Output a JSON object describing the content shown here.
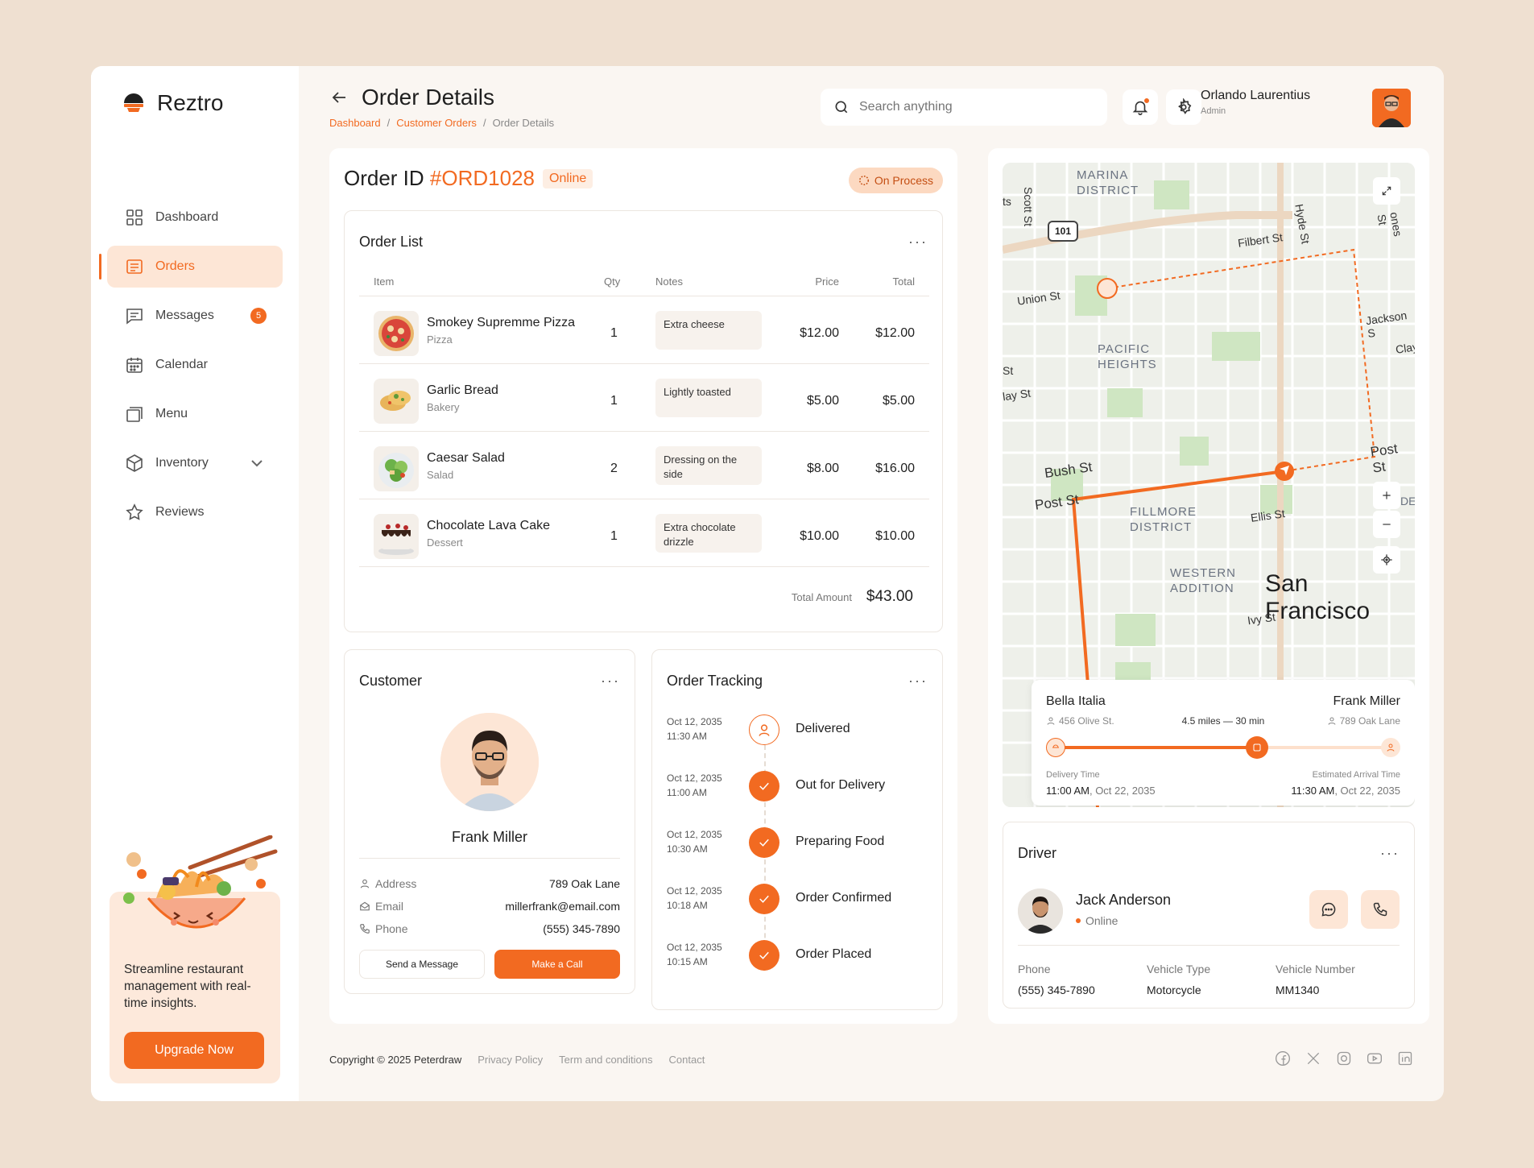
{
  "brand": {
    "name": "Reztro"
  },
  "sidebar": {
    "items": [
      {
        "label": "Dashboard",
        "icon": "grid-icon"
      },
      {
        "label": "Orders",
        "icon": "receipt-icon",
        "active": true
      },
      {
        "label": "Messages",
        "icon": "message-icon",
        "badge": "5"
      },
      {
        "label": "Calendar",
        "icon": "calendar-icon"
      },
      {
        "label": "Menu",
        "icon": "menu-book-icon"
      },
      {
        "label": "Inventory",
        "icon": "box-icon",
        "expandable": true
      },
      {
        "label": "Reviews",
        "icon": "star-icon"
      }
    ],
    "promo": {
      "text": "Streamline restaurant management with real-time insights.",
      "button": "Upgrade Now"
    }
  },
  "header": {
    "title": "Order Details",
    "breadcrumb": [
      "Dashboard",
      "Customer Orders",
      "Order Details"
    ],
    "search_placeholder": "Search anything",
    "user": {
      "name": "Orlando Laurentius",
      "role": "Admin"
    }
  },
  "order": {
    "id_label": "Order ID",
    "id": "#ORD1028",
    "channel": "Online",
    "status": "On Process",
    "list_title": "Order List",
    "columns": [
      "Item",
      "Qty",
      "Notes",
      "Price",
      "Total"
    ],
    "items": [
      {
        "name": "Smokey Supremme Pizza",
        "category": "Pizza",
        "qty": "1",
        "note": "Extra cheese",
        "price": "$12.00",
        "total": "$12.00"
      },
      {
        "name": "Garlic Bread",
        "category": "Bakery",
        "qty": "1",
        "note": "Lightly toasted",
        "price": "$5.00",
        "total": "$5.00"
      },
      {
        "name": "Caesar Salad",
        "category": "Salad",
        "qty": "2",
        "note": "Dressing on the side",
        "price": "$8.00",
        "total": "$16.00"
      },
      {
        "name": "Chocolate Lava Cake",
        "category": "Dessert",
        "qty": "1",
        "note": "Extra chocolate drizzle",
        "price": "$10.00",
        "total": "$10.00"
      }
    ],
    "total_label": "Total Amount",
    "total": "$43.00"
  },
  "customer": {
    "title": "Customer",
    "name": "Frank Miller",
    "address_label": "Address",
    "address": "789 Oak Lane",
    "email_label": "Email",
    "email": "millerfrank@email.com",
    "phone_label": "Phone",
    "phone": "(555) 345-7890",
    "message_button": "Send a Message",
    "call_button": "Make a Call"
  },
  "tracking": {
    "title": "Order Tracking",
    "steps": [
      {
        "date": "Oct 12, 2035",
        "time": "11:30 AM",
        "label": "Delivered",
        "state": "current"
      },
      {
        "date": "Oct 12, 2035",
        "time": "11:00 AM",
        "label": "Out for Delivery",
        "state": "done"
      },
      {
        "date": "Oct 12, 2035",
        "time": "10:30 AM",
        "label": "Preparing Food",
        "state": "done"
      },
      {
        "date": "Oct 12, 2035",
        "time": "10:18 AM",
        "label": "Order Confirmed",
        "state": "done"
      },
      {
        "date": "Oct 12, 2035",
        "time": "10:15 AM",
        "label": "Order Placed",
        "state": "done"
      }
    ]
  },
  "map": {
    "labels": {
      "marina": "MARINA",
      "marina2": "DISTRICT",
      "pacific": "PACIFIC",
      "pacific2": "HEIGHTS",
      "fillmore": "FILLMORE",
      "fillmore2": "DISTRICT",
      "western": "WESTERN",
      "western2": "ADDITION",
      "city": "San Francisco",
      "scott": "Scott St",
      "filbert": "Filbert St",
      "hyde": "Hyde St",
      "jones": "ones St",
      "union": "Union St",
      "jackson": "Jackson S",
      "clay": "Clay",
      "bush": "Bush St",
      "post": "Post St",
      "post2": "Post St",
      "ellis": "Ellis St",
      "ivy": "Ivy St",
      "highway": "101",
      "clay2": "lay St",
      "st": "St",
      "ts": "ts",
      "de": "DE"
    },
    "route": {
      "from_name": "Bella Italia",
      "from_addr": "456 Olive St.",
      "to_name": "Frank Miller",
      "to_addr": "789 Oak Lane",
      "distance": "4.5 miles",
      "duration": "30 min",
      "progress": 0.6,
      "delivery_label": "Delivery Time",
      "delivery_time": "11:00 AM",
      "delivery_date": ", Oct 22, 2035",
      "eta_label": "Estimated Arrival Time",
      "eta_time": "11:30 AM",
      "eta_date": ", Oct 22, 2035"
    }
  },
  "driver": {
    "title": "Driver",
    "name": "Jack Anderson",
    "status": "Online",
    "phone_label": "Phone",
    "phone": "(555) 345-7890",
    "vehicle_label": "Vehicle Type",
    "vehicle": "Motorcycle",
    "number_label": "Vehicle Number",
    "number": "MM1340"
  },
  "footer": {
    "copyright": "Copyright © 2025 Peterdraw",
    "links": [
      "Privacy Policy",
      "Term and conditions",
      "Contact"
    ],
    "socials": [
      "facebook-icon",
      "x-icon",
      "instagram-icon",
      "youtube-icon",
      "linkedin-icon"
    ]
  },
  "colors": {
    "accent": "#f26a21",
    "accent_soft": "#fde6d6",
    "bg": "#efe0d1"
  }
}
